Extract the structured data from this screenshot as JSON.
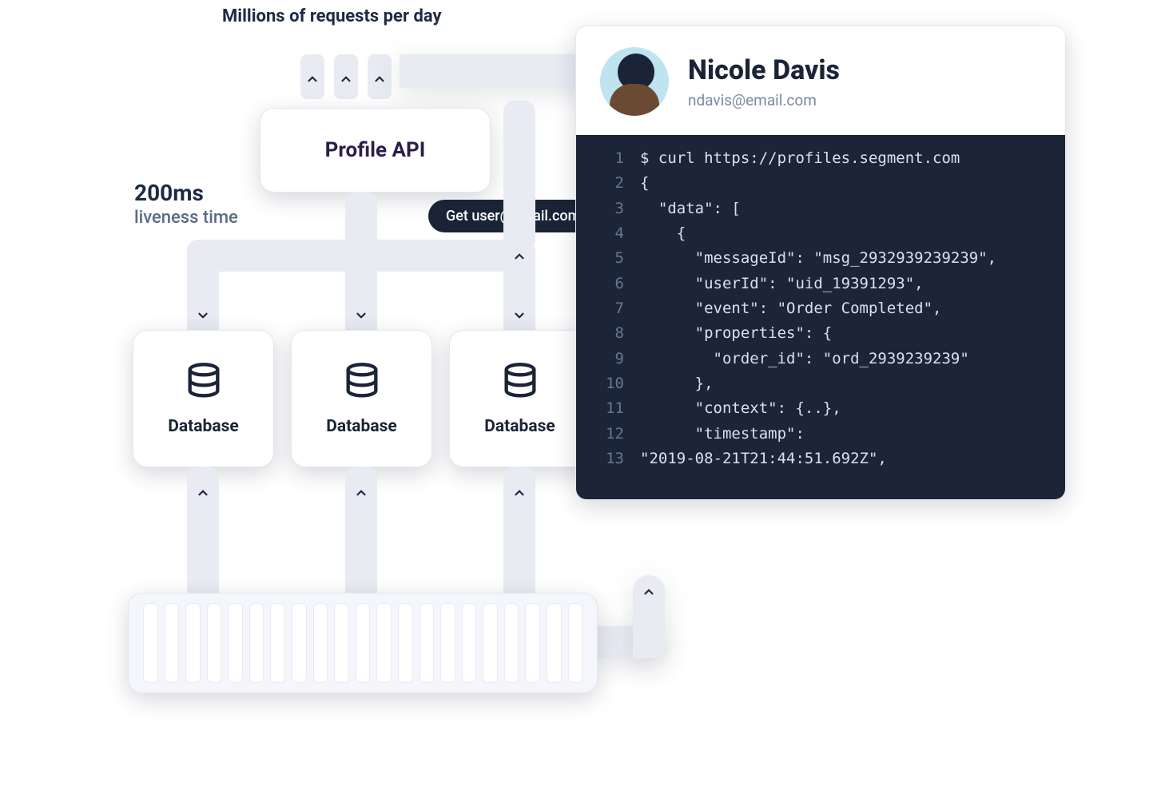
{
  "annotations": {
    "top": "Millions of requests per day",
    "left_big": "200ms",
    "left_sub": "liveness time"
  },
  "profile_api": {
    "label": "Profile API"
  },
  "request_pill": "Get user@email.com",
  "databases": [
    "Database",
    "Database",
    "Database"
  ],
  "profile_panel": {
    "name": "Nicole Davis",
    "email": "ndavis@email.com",
    "code_lines": [
      "$ curl https://profiles.segment.com",
      "{",
      "  \"data\": [",
      "    {",
      "      \"messageId\": \"msg_2932939239239\",",
      "      \"userId\": \"uid_19391293\",",
      "      \"event\": \"Order Completed\",",
      "      \"properties\": {",
      "        \"order_id\": \"ord_2939239239\"",
      "      },",
      "      \"context\": {..},",
      "      \"timestamp\":",
      "\"2019-08-21T21:44:51.692Z\","
    ]
  }
}
